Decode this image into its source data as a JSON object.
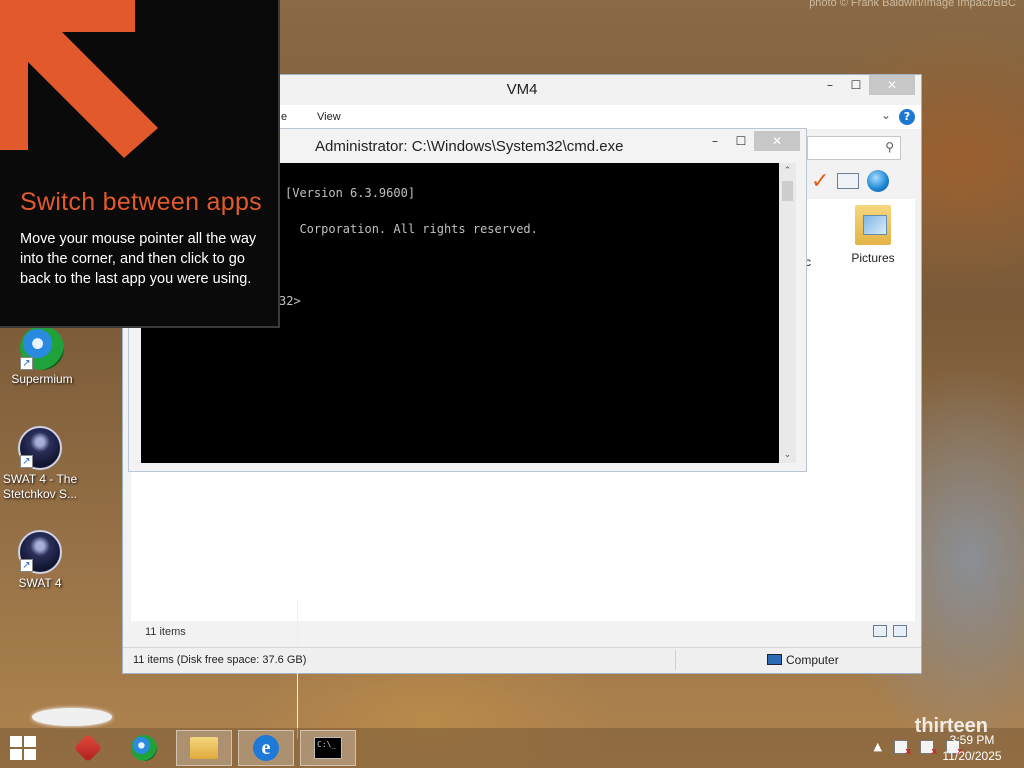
{
  "credit": "photo © Frank Baldwin/Image Impact/BBC",
  "desktop_icons": [
    {
      "label": "Supermium",
      "icon": "browser-icon"
    },
    {
      "label": "SWAT 4 - The Stetchkov S...",
      "icon": "swat4-icon"
    },
    {
      "label": "SWAT 4",
      "icon": "swat4-icon"
    }
  ],
  "explorer": {
    "title": "VM4",
    "menu": {
      "partial_tab": "e",
      "view": "View"
    },
    "help": "?",
    "partial_item_label": "c",
    "folder_label": "Pictures",
    "items_count": "11 items",
    "status_left": "11 items (Disk free space: 37.6 GB)",
    "status_right": "Computer"
  },
  "cmd": {
    "title": "Administrator: C:\\Windows\\System32\\cmd.exe",
    "lines": [
      "[Version 6.3.9600]",
      "  Corporation. All rights reserved.",
      "",
      "32>"
    ]
  },
  "tip": {
    "title": "Switch between apps",
    "body": "Move your mouse pointer all the way into the corner, and then click to go back to the last app you were using.",
    "accent": "#e25a2c"
  },
  "taskbar": {
    "buttons": [
      {
        "name": "file-explorer",
        "icon": "folder-icon"
      },
      {
        "name": "internet-explorer",
        "icon": "ie-icon",
        "glyph": "e"
      },
      {
        "name": "command-prompt",
        "icon": "cmd-icon",
        "glyph": "C:\\_"
      }
    ],
    "tray_up": "▲",
    "time": "3:59 PM",
    "date": "11/20/2025",
    "watermark": "thirteen"
  }
}
